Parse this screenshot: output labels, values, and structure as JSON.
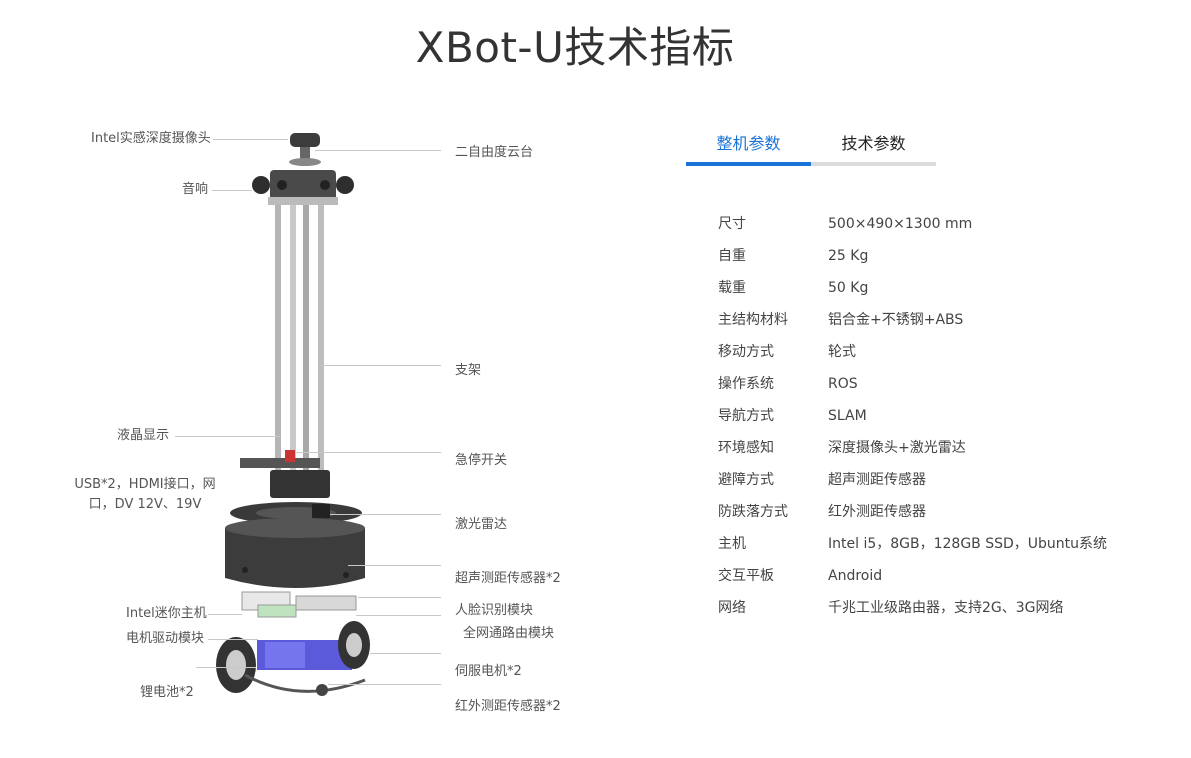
{
  "title": "XBot-U技术指标",
  "diagram": {
    "labels_left": {
      "camera": "Intel实感深度摄像头",
      "speaker": "音响",
      "lcd": "液晶显示",
      "ports": "USB*2，HDMI接口，网口，DV 12V、19V",
      "mini_pc": "Intel迷你主机",
      "motor_driver": "电机驱动模块",
      "battery": "锂电池*2"
    },
    "labels_right": {
      "pan_tilt": "二自由度云台",
      "bracket": "支架",
      "estop": "急停开关",
      "lidar": "激光雷达",
      "ultrasonic": "超声测距传感器*2",
      "face": "人脸识别模块",
      "router": "全网通路由模块",
      "servo": "伺服电机*2",
      "infrared": "红外测距传感器*2"
    }
  },
  "tabs": [
    "整机参数",
    "技术参数"
  ],
  "specs": [
    {
      "k": "尺寸",
      "v": "500×490×1300 mm"
    },
    {
      "k": "自重",
      "v": "25 Kg"
    },
    {
      "k": "载重",
      "v": "50 Kg"
    },
    {
      "k": "主结构材料",
      "v": "铝合金+不锈钢+ABS"
    },
    {
      "k": "移动方式",
      "v": "轮式"
    },
    {
      "k": "操作系统",
      "v": "ROS"
    },
    {
      "k": "导航方式",
      "v": "SLAM"
    },
    {
      "k": "环境感知",
      "v": "深度摄像头+激光雷达"
    },
    {
      "k": "避障方式",
      "v": "超声测距传感器"
    },
    {
      "k": "防跌落方式",
      "v": "红外测距传感器"
    },
    {
      "k": "主机",
      "v": "Intel i5，8GB，128GB SSD，Ubuntu系统"
    },
    {
      "k": "交互平板",
      "v": "Android"
    },
    {
      "k": "网络",
      "v": "千兆工业级路由器，支持2G、3G网络"
    }
  ]
}
